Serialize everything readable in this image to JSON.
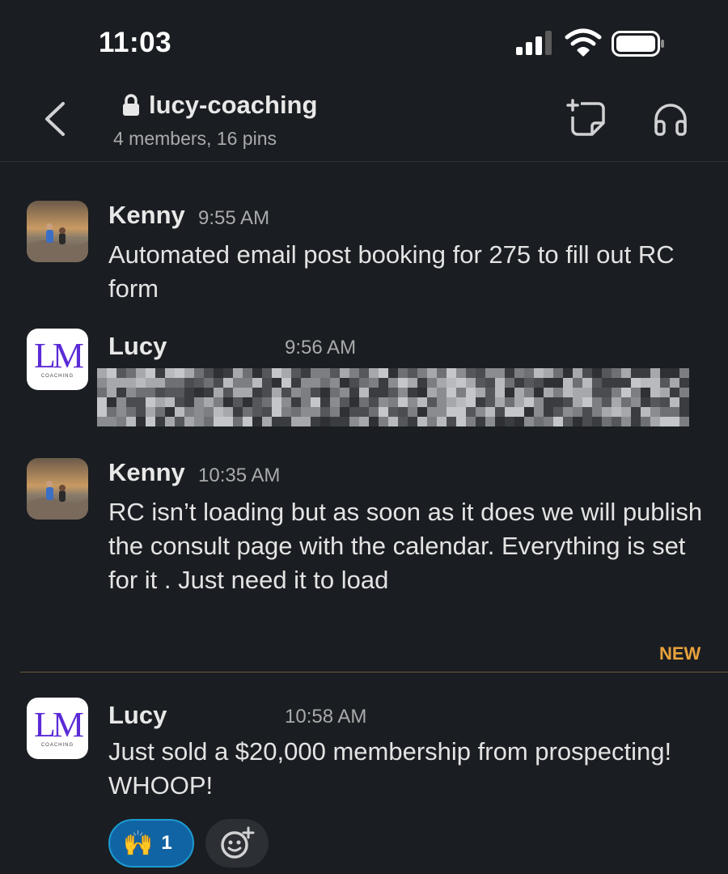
{
  "status_bar": {
    "time": "11:03"
  },
  "header": {
    "channel_name": "lucy-coaching",
    "channel_meta": "4 members, 16 pins"
  },
  "messages": [
    {
      "sender": "Kenny",
      "time": "9:55 AM",
      "text": "Automated email post booking for 275 to fill out  RC form",
      "avatar": "kenny-photo"
    },
    {
      "sender": "Lucy",
      "time": "9:56 AM",
      "text": "",
      "avatar": "lm-coaching-logo",
      "redacted": true
    },
    {
      "sender": "Kenny",
      "time": "10:35 AM",
      "text": "RC isn’t loading but as soon as it does we will publish the consult page with the calendar. Everything is set for it . Just need it to load",
      "avatar": "kenny-photo"
    },
    {
      "sender": "Lucy",
      "time": "10:58 AM",
      "text": "Just sold a $20,000 membership from prospecting! WHOOP!",
      "avatar": "lm-coaching-logo"
    }
  ],
  "new_label": "NEW",
  "logo": {
    "letters": "LM",
    "sub": "COACHING"
  },
  "reactions": [
    {
      "emoji": "🙌",
      "count": "1"
    }
  ],
  "colors": {
    "background": "#1a1d21",
    "new_accent": "#e8a23c",
    "reaction_active": "#1164a3"
  }
}
